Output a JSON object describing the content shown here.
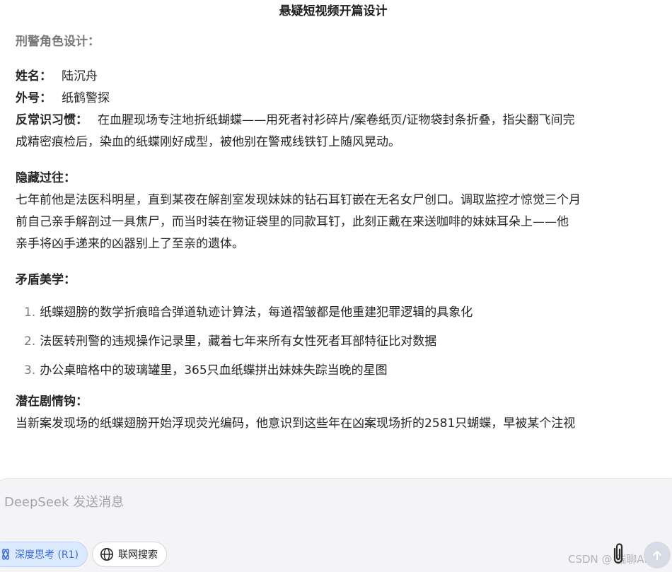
{
  "doc": {
    "title": "悬疑短视频开篇设计",
    "role_heading": "刑警角色设计：",
    "fields": [
      {
        "key": "姓名：",
        "value": "陆沉舟"
      },
      {
        "key": "外号：",
        "value": "纸鹤警探"
      },
      {
        "key": "反常识习惯：",
        "value": "在血腥现场专注地折纸蝴蝶——用死者衬衫碎片/案卷纸页/证物袋封条折叠，指尖翻飞间完"
      }
    ],
    "habit_cont": "成精密痕检后，染血的纸蝶刚好成型，被他别在警戒线铁钉上随风晃动。",
    "past_heading": "隐藏过往：",
    "past_lines": [
      "七年前他是法医科明星，直到某夜在解剖室发现妹妹的钻石耳钉嵌在无名女尸创口。调取监控才惊觉三个月",
      "前自己亲手解剖过一具焦尸，而当时装在物证袋里的同款耳钉，此刻正戴在来送咖啡的妹妹耳朵上——他",
      "亲手将凶手递来的凶器别上了至亲的遗体。"
    ],
    "aesthetics_heading": "矛盾美学：",
    "aesthetics_items": [
      {
        "num": "1.",
        "text": "纸蝶翅膀的数学折痕暗合弹道轨迹计算法，每道褶皱都是他重建犯罪逻辑的具象化"
      },
      {
        "num": "2.",
        "text": "法医转刑警的违规操作记录里，藏着七年来所有女性死者耳部特征比对数据"
      },
      {
        "num": "3.",
        "text": "办公桌暗格中的玻璃罐里，365只血纸蝶拼出妹妹失踪当晚的星图"
      }
    ],
    "hook_heading": "潜在剧情钩：",
    "hook_line": "当新案发现场的纸蝶翅膀开始浮现荧光编码，他意识到这些年在凶案现场折的2581只蝴蝶，早被某个注视"
  },
  "composer": {
    "placeholder": "DeepSeek 发送消息",
    "think_label": "深度思考 (R1)",
    "search_label": "联网搜索"
  },
  "watermark": "CSDN @ 瑞聊AI",
  "icons": {
    "think": "atom-icon",
    "search": "globe-icon",
    "attach": "paperclip-icon",
    "send": "arrow-up-icon"
  },
  "colors": {
    "accent": "#3e6ae1",
    "accent_bg": "#dbe9ff",
    "muted": "#7a7a7a"
  }
}
